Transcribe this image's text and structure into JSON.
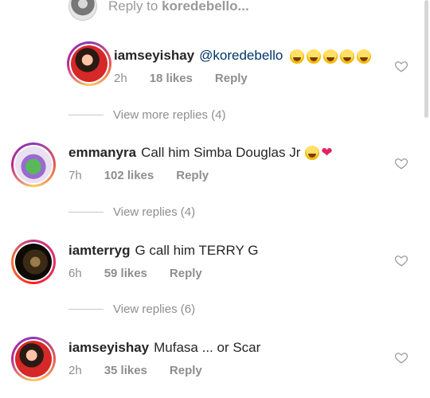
{
  "reply_bar": {
    "prefix": "Reply to ",
    "username": "koredebello..."
  },
  "comments": [
    {
      "username": "iamseyishay",
      "mention": "@koredebello",
      "text": "",
      "emojis": 5,
      "time": "2h",
      "likes": "18 likes",
      "reply": "Reply"
    },
    {
      "username": "emmanyra",
      "text": "Call him Simba Douglas Jr",
      "emojis": 1,
      "heart": true,
      "time": "7h",
      "likes": "102 likes",
      "reply": "Reply"
    },
    {
      "username": "iamterryg",
      "text": "G call him TERRY G",
      "time": "6h",
      "likes": "59 likes",
      "reply": "Reply"
    },
    {
      "username": "iamseyishay",
      "text": "Mufasa ... or Scar",
      "time": "2h",
      "likes": "35 likes",
      "reply": "Reply"
    }
  ],
  "view_more": "View more replies (4)",
  "view_replies_1": "View replies (4)",
  "view_replies_2": "View replies (6)",
  "icons": {
    "like": "heart-outline-icon",
    "laugh": "laughing-emoji-icon",
    "heart": "red-heart-icon"
  }
}
